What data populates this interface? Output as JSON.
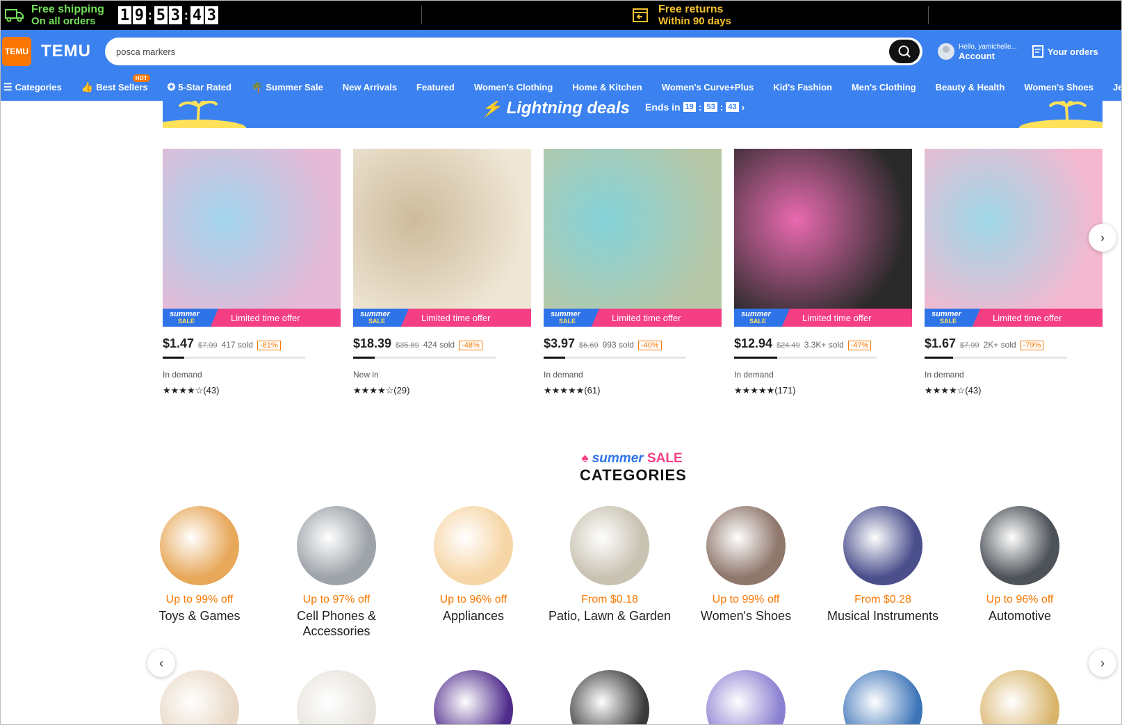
{
  "promo": {
    "shipping_line1": "Free shipping",
    "shipping_line2": "On all orders",
    "timer": [
      "1",
      "9",
      "5",
      "3",
      "4",
      "3"
    ],
    "returns_line1": "Free returns",
    "returns_line2": "Within 90 days"
  },
  "header": {
    "logo_text": "TEMU",
    "brand": "TEMU",
    "search_value": "posca markers",
    "account_greeting": "Hello, yamichelle...",
    "account_label": "Account",
    "orders_label": "Your orders"
  },
  "nav": {
    "items": [
      {
        "label": "Categories"
      },
      {
        "label": "Best Sellers",
        "badge": "HOT"
      },
      {
        "label": "5-Star Rated"
      },
      {
        "label": "Summer Sale"
      },
      {
        "label": "New Arrivals"
      },
      {
        "label": "Featured"
      },
      {
        "label": "Women's Clothing"
      },
      {
        "label": "Home & Kitchen"
      },
      {
        "label": "Women's Curve+Plus"
      },
      {
        "label": "Kid's Fashion"
      },
      {
        "label": "Men's Clothing"
      },
      {
        "label": "Beauty & Health"
      },
      {
        "label": "Women's Shoes"
      },
      {
        "label": "Jewelry &"
      }
    ]
  },
  "lightning": {
    "title": "Lightning deals",
    "ends_label": "Ends in",
    "h": "19",
    "m": "53",
    "s": "43"
  },
  "products": [
    {
      "badge_top": "summer",
      "badge_bottom": "SALE",
      "offer": "Limited time offer",
      "price": "$1.47",
      "old_price": "$7.99",
      "sold": "417 sold",
      "discount": "-81%",
      "progress": 0.15,
      "status": "In demand",
      "stars": "★★★★☆",
      "reviews": "(43)",
      "colors": [
        "#e6b9d6",
        "#a3d6ef"
      ]
    },
    {
      "badge_top": "summer",
      "badge_bottom": "SALE",
      "offer": "Limited time offer",
      "price": "$18.39",
      "old_price": "$35.89",
      "sold": "424 sold",
      "discount": "-48%",
      "progress": 0.15,
      "status": "New in",
      "stars": "★★★★☆",
      "reviews": "(29)",
      "colors": [
        "#efe6d5",
        "#cdbb9b"
      ]
    },
    {
      "badge_top": "summer",
      "badge_bottom": "SALE",
      "offer": "Limited time offer",
      "price": "$3.97",
      "old_price": "$6.69",
      "sold": "993 sold",
      "discount": "-40%",
      "progress": 0.15,
      "status": "In demand",
      "stars": "★★★★★",
      "reviews": "(61)",
      "colors": [
        "#b6c7a7",
        "#84d3da"
      ]
    },
    {
      "badge_top": "summer",
      "badge_bottom": "SALE",
      "offer": "Limited time offer",
      "price": "$12.94",
      "old_price": "$24.49",
      "sold": "3.3K+ sold",
      "discount": "-47%",
      "progress": 0.3,
      "status": "In demand",
      "stars": "★★★★★",
      "reviews": "(171)",
      "colors": [
        "#2a2a2a",
        "#e96ab0"
      ]
    },
    {
      "badge_top": "summer",
      "badge_bottom": "SALE",
      "offer": "Limited time offer",
      "price": "$1.67",
      "old_price": "$7.99",
      "sold": "2K+ sold",
      "discount": "-79%",
      "progress": 0.2,
      "status": "In demand",
      "stars": "★★★★☆",
      "reviews": "(43)",
      "colors": [
        "#f4b8d0",
        "#9ed8e8"
      ]
    }
  ],
  "categories_header": {
    "summer": "summer",
    "sale": "SALE",
    "title": "CATEGORIES"
  },
  "categories": [
    {
      "offer": "Up to 99% off",
      "name": "Toys & Games",
      "color": "#e7a85a"
    },
    {
      "offer": "Up to 97% off",
      "name": "Cell Phones & Accessories",
      "color": "#9da3a9"
    },
    {
      "offer": "Up to 96% off",
      "name": "Appliances",
      "color": "#f6d6a6"
    },
    {
      "offer": "From $0.18",
      "name": "Patio, Lawn & Garden",
      "color": "#c9c2b2"
    },
    {
      "offer": "Up to 99% off",
      "name": "Women's Shoes",
      "color": "#8f776c"
    },
    {
      "offer": "From $0.28",
      "name": "Musical Instruments",
      "color": "#4a4f8c"
    },
    {
      "offer": "Up to 96% off",
      "name": "Automotive",
      "color": "#4d5359"
    }
  ],
  "second_row_colors": [
    "#e9d8c5",
    "#e6e2da",
    "#4f2b8b",
    "#3a3a3a",
    "#8a7fd1",
    "#3c74b8",
    "#d8b46a"
  ],
  "colors": {
    "brand_blue": "#3b82f0",
    "accent_orange": "#fb7701",
    "sale_pink": "#f43f84",
    "promo_green": "#74e05a",
    "promo_yellow": "#f4c22e"
  }
}
